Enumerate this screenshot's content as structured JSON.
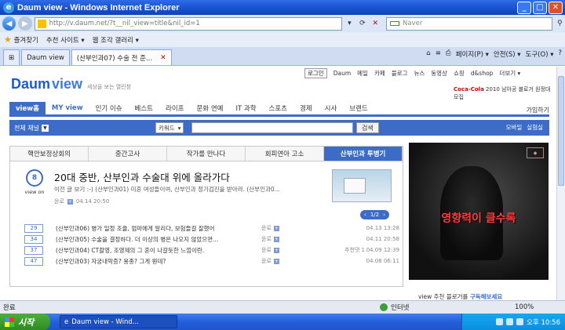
{
  "window": {
    "title": "Daum view - Windows Internet Explorer"
  },
  "address": {
    "url": "http://v.daum.net/?t__nil_view=title&nil_id=1",
    "search_placeholder": "Naver"
  },
  "favbar": {
    "favorites": "즐겨찾기",
    "suggested": "추천 사이트 ▾",
    "gallery": "웹 조각 갤러리 ▾"
  },
  "tabs": [
    {
      "label": "Daum view"
    },
    {
      "label": "(산부인과07) 수술 전 준..."
    }
  ],
  "ie_toolbar": {
    "page": "페이지(P) ▾",
    "safety": "안전(S) ▾",
    "tools": "도구(O) ▾",
    "help": "?"
  },
  "site": {
    "logo_daum": "Daum",
    "logo_view": "view",
    "slogan": "세상을 보는 열린창",
    "toplinks": [
      "로그인",
      "Daum",
      "메일",
      "카페",
      "블로그",
      "뉴스",
      "동영상",
      "쇼핑",
      "d&shop",
      "더보기 ▾"
    ],
    "promo_brand": "Coca-Cola",
    "promo_text": "2010 남아공 블로거 원정대 모집",
    "nav": [
      "view홈",
      "MY view",
      "인기 이슈",
      "베스트",
      "라이프",
      "문화 연예",
      "IT 과학",
      "스포츠",
      "경제",
      "시사",
      "브랜드"
    ],
    "join": "가입하기",
    "search": {
      "channel": "전체 채널",
      "field": "키워드",
      "button": "검색",
      "mobile": "모바일",
      "lab": "실험실"
    },
    "story_tabs": [
      "핵안보정상회의",
      "중간고사",
      "작가를 만나다",
      "회피연아 고소",
      "산부인과 투병기"
    ],
    "featured": {
      "count": "8",
      "count_label": "view on",
      "title": "20대 중반, 산부인과 수술대 위에 올라가다",
      "summary": "이전 글 보기 :-) (산부인과01) 미혼 여성들이여, 산부인과 정기검진을 받아라. (산부인과0...",
      "source": "윤로",
      "date": "04.14 20:50"
    },
    "pager": "1/2",
    "rows": [
      {
        "count": "29",
        "text": "(산부인과06) 병가 일정 조율, 엄마에게 알리다, 보험들걸 잘했어",
        "source": "윤로",
        "date": "04.13 13:28"
      },
      {
        "count": "34",
        "text": "(산부인과05) 수술을 결정하다. 더 이상의 병은 나오지 않았으면...",
        "source": "윤로",
        "date": "04.11 20:58"
      },
      {
        "count": "37",
        "text": "(산부인과04) CT촬영, 조영제의 그 혼이 나갈듯한 느낌이란.",
        "source": "윤로",
        "date": "04.09 12:39",
        "extra": "추천댓 1"
      },
      {
        "count": "47",
        "text": "(산부인과03) 자궁내막증? 용종? 그게 뭔데?",
        "source": "윤로",
        "date": "04.08 06:11"
      }
    ],
    "ad_copy": "영향력이 클수록",
    "recommend_prefix": "view 추천 블로거를 ",
    "recommend_link": "구독해보세요"
  },
  "status": {
    "text": "완료",
    "zone": "인터넷",
    "zoom": "100%"
  },
  "taskbar": {
    "start": "시작",
    "window": "Daum view - Wind...",
    "clock": "오후 10:56"
  }
}
